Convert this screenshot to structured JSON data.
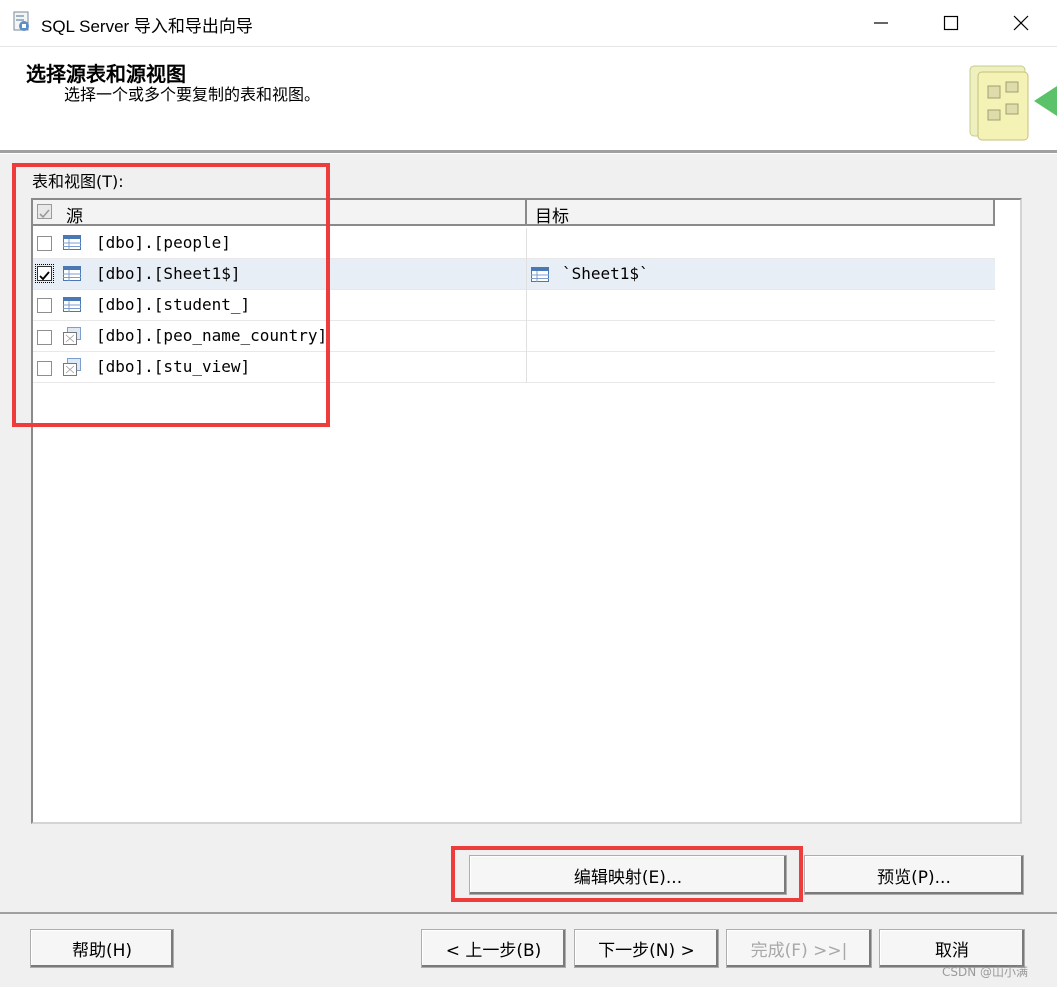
{
  "window": {
    "title": "SQL Server 导入和导出向导",
    "minimize_icon": "minimize-icon",
    "maximize_icon": "maximize-icon",
    "close_icon": "close-icon"
  },
  "header": {
    "title": "选择源表和源视图",
    "subtitle": "选择一个或多个要复制的表和视图。"
  },
  "tables_label": "表和视图(T):",
  "grid": {
    "columns": [
      "源",
      "目标"
    ],
    "rows": [
      {
        "source": "[dbo].[people]",
        "destination": "",
        "checked": false,
        "icon": "table-icon"
      },
      {
        "source": "[dbo].[Sheet1$]",
        "destination": "`Sheet1$`",
        "checked": true,
        "icon": "table-icon"
      },
      {
        "source": "[dbo].[student_]",
        "destination": "",
        "checked": false,
        "icon": "table-icon"
      },
      {
        "source": "[dbo].[peo_name_country]",
        "destination": "",
        "checked": false,
        "icon": "view-icon"
      },
      {
        "source": "[dbo].[stu_view]",
        "destination": "",
        "checked": false,
        "icon": "view-icon"
      }
    ]
  },
  "buttons": {
    "edit_mappings": "编辑映射(E)...",
    "preview": "预览(P)...",
    "help": "帮助(H)",
    "back": "< 上一步(B)",
    "next": "下一步(N) >",
    "finish": "完成(F) >>|",
    "cancel": "取消"
  },
  "watermark": "CSDN @山小满",
  "colors": {
    "highlight": "#ee3b3b",
    "selected_row": "#e8eef5"
  }
}
